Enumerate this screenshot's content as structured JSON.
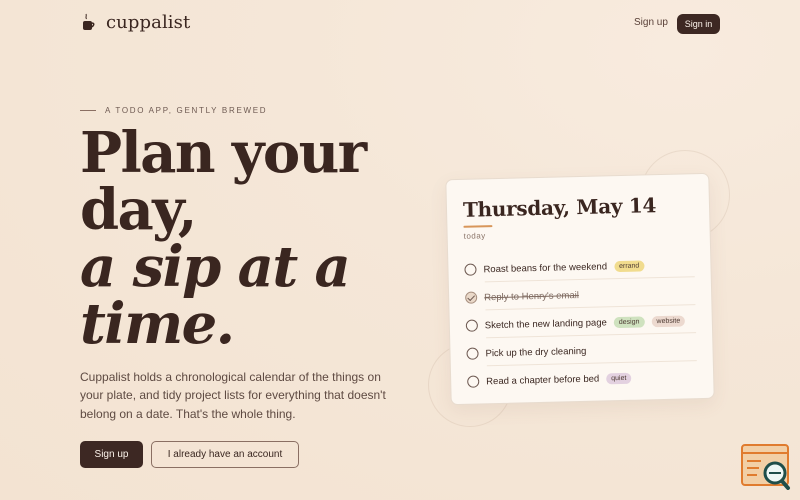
{
  "header": {
    "brand": "cuppalist",
    "nav_signup": "Sign up",
    "nav_signin": "Sign in"
  },
  "hero": {
    "eyebrow": "A TODO APP, GENTLY BREWED",
    "headline_line1": "Plan your",
    "headline_line2": "day,",
    "headline_line3": "a sip at a",
    "headline_line4": "time.",
    "description": "Cuppalist holds a chronological calendar of the things on your plate, and tidy project lists for everything that doesn't belong on a date. That's the whole thing.",
    "primary_cta": "Sign up",
    "secondary_cta": "I already have an account"
  },
  "card": {
    "title": "Thursday, May 14",
    "subtitle": "today",
    "tasks": [
      {
        "label": "Roast beans for the weekend",
        "done": false,
        "tags": [
          {
            "label": "errand",
            "color": "#f1dc8e"
          }
        ]
      },
      {
        "label": "Reply to Henry's email",
        "done": true,
        "tags": []
      },
      {
        "label": "Sketch the new landing page",
        "done": false,
        "tags": [
          {
            "label": "design",
            "color": "#cfe2bf"
          },
          {
            "label": "website",
            "color": "#ecd9cf"
          }
        ]
      },
      {
        "label": "Pick up the dry cleaning",
        "done": false,
        "tags": []
      },
      {
        "label": "Read a chapter before bed",
        "done": false,
        "tags": [
          {
            "label": "quiet",
            "color": "#e3d1e0"
          }
        ]
      }
    ]
  },
  "icons": {
    "logo": "coffee-cup-icon",
    "corner": "browser-search-icon"
  },
  "colors": {
    "background": "#f5e7d8",
    "primary": "#3d2823",
    "accent": "#d8965a"
  }
}
